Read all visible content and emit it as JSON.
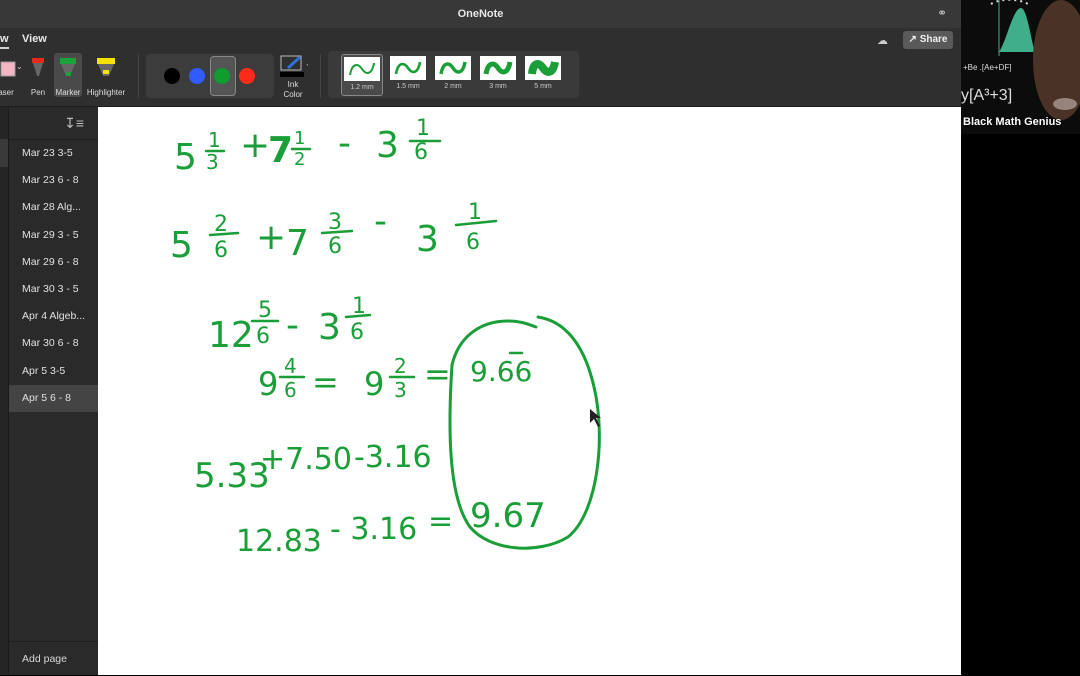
{
  "window": {
    "title": "OneNote"
  },
  "ribbon": {
    "tabs": [
      {
        "label": "w"
      },
      {
        "label": "View"
      }
    ],
    "tools": [
      {
        "label": "aser",
        "icon": "eraser-icon"
      },
      {
        "label": "Pen",
        "icon": "pen-icon"
      },
      {
        "label": "Marker",
        "icon": "marker-icon",
        "selected": true
      },
      {
        "label": "Highlighter",
        "icon": "highlighter-icon"
      }
    ],
    "colors": [
      {
        "name": "black",
        "hex": "#000000"
      },
      {
        "name": "blue",
        "hex": "#2f5bff"
      },
      {
        "name": "green",
        "hex": "#0f9d2f",
        "selected": true
      },
      {
        "name": "red",
        "hex": "#ff2a1a"
      }
    ],
    "ink_color_label": "Ink Color",
    "thickness": [
      {
        "label": "1.2 mm",
        "selected": true
      },
      {
        "label": "1.5 mm"
      },
      {
        "label": "2 mm"
      },
      {
        "label": "3 mm"
      },
      {
        "label": "5 mm"
      }
    ],
    "share_label": "Share"
  },
  "pages": {
    "items": [
      {
        "label": "Mar 23 3-5"
      },
      {
        "label": "Mar 23 6 - 8"
      },
      {
        "label": "Mar 28 Alg..."
      },
      {
        "label": "Mar 29 3 - 5"
      },
      {
        "label": "Mar 29 6 - 8"
      },
      {
        "label": "Mar 30 3 - 5"
      },
      {
        "label": "Apr 4 Algeb..."
      },
      {
        "label": "Mar 30 6 - 8"
      },
      {
        "label": "Apr 5 3-5"
      },
      {
        "label": "Apr 5 6 - 8",
        "selected": true
      }
    ],
    "add_page_label": "Add page"
  },
  "canvas": {
    "ink_color": "#1a9e37",
    "handwriting": [
      "5 1/3 + 7 1/2 - 3 1/6",
      "5 2/6 + 7 3/6 - 3 1/6",
      "12 5/6 - 3 1/6",
      "9 4/6 = 9 2/3 = 9.6̄6",
      "5.33 + 7.50 - 3.16",
      "12.83 - 3.16 = 9.67"
    ]
  },
  "video": {
    "participant_name": "Black Math Genius"
  }
}
